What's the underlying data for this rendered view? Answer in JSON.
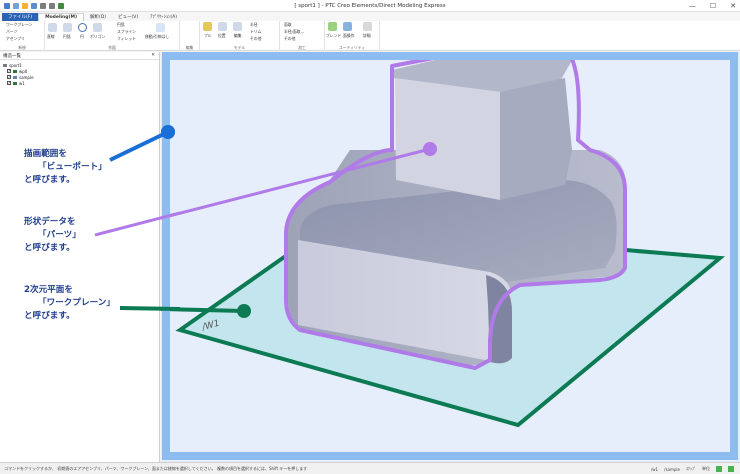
{
  "window": {
    "title": "[ sport1 ] - PTC Creo Elements/Direct Modeling Express",
    "minimize": "—",
    "maximize": "☐",
    "close": "✕"
  },
  "tabs": [
    {
      "label": "ファイル(F)"
    },
    {
      "label": "Modeling(M)"
    },
    {
      "label": "解析(D)"
    },
    {
      "label": "ビュー(V)"
    },
    {
      "label": "ｱﾌﾟﾘｹｰｼｮﾝ(A)"
    }
  ],
  "ribbon": {
    "workplane_items": [
      "ワークプレーン",
      "パーツ",
      "アセンブリ"
    ],
    "groups": [
      "新規",
      "作図",
      "編集",
      "モデル",
      "加工",
      "ユーティリティ"
    ],
    "draw_items": [
      "直線",
      "円弧",
      "円",
      "ポリゴン",
      "円弧",
      "スプライン",
      "フィレット",
      "移動/引伸ばし"
    ],
    "model_items": [
      "プル",
      "位置",
      "編集",
      "半径",
      "トリム",
      "その他"
    ],
    "machining_items": [
      "面取",
      "半径/面取...",
      "その他"
    ],
    "util_items": [
      "ブレンド",
      "面操作",
      "詳細"
    ]
  },
  "panel": {
    "title": "構造一覧",
    "tree": [
      {
        "label": "sport1"
      },
      {
        "label": "wp0"
      },
      {
        "label": "sample"
      },
      {
        "label": "w1"
      }
    ]
  },
  "viewport": {
    "workplane_label": "/W1"
  },
  "annotations": {
    "viewport_text": [
      "描画範囲を",
      "「ビューポート」",
      "と呼びます。"
    ],
    "parts_text": [
      "形状データを",
      "「パーツ」",
      "と呼びます。"
    ],
    "workplane_text": [
      "2次元平面を",
      "「ワークプレーン」",
      "と呼びます。"
    ]
  },
  "statusbar": {
    "message": "コマンドをクリックするか、 初期値のエアアセンブリ、パーツ、ワークプレーン、面または稜線を選択してください。 複数の項目を選択するには、Shift キーを押します",
    "wp": "/w1",
    "part": "/sample",
    "view": "ｽﾅｯﾌﾟ",
    "mode": "単位"
  },
  "colors": {
    "viewport_marker": "#1a6fd6",
    "parts_marker": "#b07be8",
    "workplane_marker": "#0c7a52",
    "viewport_frame": "#8cbcf0"
  }
}
